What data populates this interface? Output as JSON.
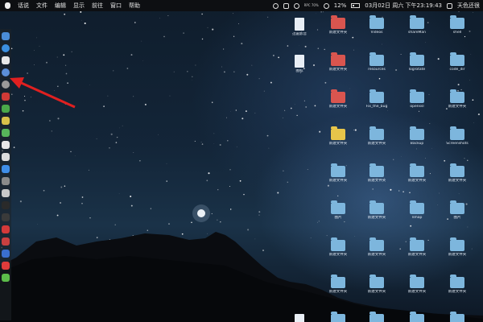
{
  "menubar": {
    "menus": [
      "话说",
      "文件",
      "编辑",
      "显示",
      "前往",
      "窗口",
      "帮助"
    ],
    "status_small": "RPC 70%",
    "date_time": "03月02日 周六 下午23:19:43",
    "battery_pct": "12%",
    "weather": "天色还很"
  },
  "dock": {
    "items": [
      {
        "icon": "finder-icon",
        "color": "#4a8cd6"
      },
      {
        "icon": "safari-icon",
        "color": "#3b8fe0"
      },
      {
        "icon": "calendar-icon",
        "color": "#e8e8e8"
      },
      {
        "icon": "browser-icon",
        "color": "#5b8ed8"
      },
      {
        "icon": "chrome-icon",
        "color": "#9a9a9a"
      },
      {
        "icon": "app-icon-red",
        "color": "#d03a36"
      },
      {
        "icon": "app-icon-green",
        "color": "#4aa84a"
      },
      {
        "icon": "notes-icon",
        "color": "#d8c04a"
      },
      {
        "icon": "messages-icon",
        "color": "#57b65a"
      },
      {
        "icon": "document-icon",
        "color": "#e8e8e8"
      },
      {
        "icon": "document-icon",
        "color": "#dcdcdc"
      },
      {
        "icon": "appstore-icon",
        "color": "#3f8ee8"
      },
      {
        "icon": "system-preferences-icon",
        "color": "#8a8a8a"
      },
      {
        "icon": "photo-icon",
        "color": "#c9c9c9"
      },
      {
        "icon": "terminal-icon",
        "color": "#2a2a2a"
      },
      {
        "icon": "app-icon-dark",
        "color": "#3a3a3a"
      },
      {
        "icon": "vivaldi-icon",
        "color": "#d33a3a"
      },
      {
        "icon": "app-icon-red2",
        "color": "#c94040"
      },
      {
        "icon": "app-icon-blue",
        "color": "#3a6fd0"
      },
      {
        "icon": "yandex-icon",
        "color": "#e03b3b"
      },
      {
        "icon": "wechat-icon",
        "color": "#5cbd4a"
      }
    ]
  },
  "desktop": {
    "icons": [
      {
        "col": 0,
        "row": 0,
        "type": "doc",
        "label": "迅雷影音"
      },
      {
        "col": 1,
        "row": 0,
        "type": "red",
        "label": "新建文件夹"
      },
      {
        "col": 2,
        "row": 0,
        "type": "blue",
        "label": "Videos"
      },
      {
        "col": 3,
        "row": 0,
        "type": "blue",
        "label": "shareMan"
      },
      {
        "col": 4,
        "row": 0,
        "type": "blue",
        "label": "shell"
      },
      {
        "col": 0,
        "row": 1,
        "type": "doc",
        "label": "图标"
      },
      {
        "col": 1,
        "row": 1,
        "type": "red",
        "label": "新建文件夹"
      },
      {
        "col": 2,
        "row": 1,
        "type": "blue",
        "label": "resources"
      },
      {
        "col": 3,
        "row": 1,
        "type": "blue",
        "label": "logrotate"
      },
      {
        "col": 4,
        "row": 1,
        "type": "blue",
        "label": "code_dir"
      },
      {
        "col": 1,
        "row": 2,
        "type": "red",
        "label": "新建文件夹"
      },
      {
        "col": 2,
        "row": 2,
        "type": "blue",
        "label": "Fix_the_bug"
      },
      {
        "col": 3,
        "row": 2,
        "type": "blue",
        "label": "openssl"
      },
      {
        "col": 4,
        "row": 2,
        "type": "blue",
        "label": "新建文件夹"
      },
      {
        "col": 1,
        "row": 3,
        "type": "yellow",
        "label": "新建文件夹"
      },
      {
        "col": 2,
        "row": 3,
        "type": "blue",
        "label": "新建文件夹"
      },
      {
        "col": 3,
        "row": 3,
        "type": "blue",
        "label": "Backup"
      },
      {
        "col": 4,
        "row": 3,
        "type": "blue",
        "label": "Screenshots"
      },
      {
        "col": 1,
        "row": 4,
        "type": "blue",
        "label": "新建文件夹"
      },
      {
        "col": 2,
        "row": 4,
        "type": "blue",
        "label": "新建文件夹"
      },
      {
        "col": 3,
        "row": 4,
        "type": "blue",
        "label": "新建文件夹"
      },
      {
        "col": 4,
        "row": 4,
        "type": "blue",
        "label": "新建文件夹"
      },
      {
        "col": 1,
        "row": 5,
        "type": "blue",
        "label": "图片"
      },
      {
        "col": 2,
        "row": 5,
        "type": "blue",
        "label": "新建文件夹"
      },
      {
        "col": 3,
        "row": 5,
        "type": "blue",
        "label": "nmap"
      },
      {
        "col": 4,
        "row": 5,
        "type": "blue",
        "label": "图片"
      },
      {
        "col": 1,
        "row": 6,
        "type": "blue",
        "label": "新建文件夹"
      },
      {
        "col": 2,
        "row": 6,
        "type": "blue",
        "label": "新建文件夹"
      },
      {
        "col": 3,
        "row": 6,
        "type": "blue",
        "label": "新建文件夹"
      },
      {
        "col": 4,
        "row": 6,
        "type": "blue",
        "label": "新建文件夹"
      },
      {
        "col": 1,
        "row": 7,
        "type": "blue",
        "label": "新建文件夹"
      },
      {
        "col": 2,
        "row": 7,
        "type": "blue",
        "label": "新建文件夹"
      },
      {
        "col": 3,
        "row": 7,
        "type": "blue",
        "label": "新建文件夹"
      },
      {
        "col": 4,
        "row": 7,
        "type": "blue",
        "label": "新建文件夹"
      },
      {
        "col": 0,
        "row": 8,
        "type": "doc",
        "label": "文档"
      },
      {
        "col": 1,
        "row": 8,
        "type": "blue",
        "label": "新建文件夹"
      },
      {
        "col": 2,
        "row": 8,
        "type": "blue",
        "label": "新建文件夹"
      },
      {
        "col": 3,
        "row": 8,
        "type": "blue",
        "label": "新建文件夹"
      },
      {
        "col": 4,
        "row": 8,
        "type": "blue",
        "label": "新建文件夹"
      }
    ]
  },
  "colors": {
    "arrow": "#e02020",
    "menubar": "#0d0f12"
  }
}
